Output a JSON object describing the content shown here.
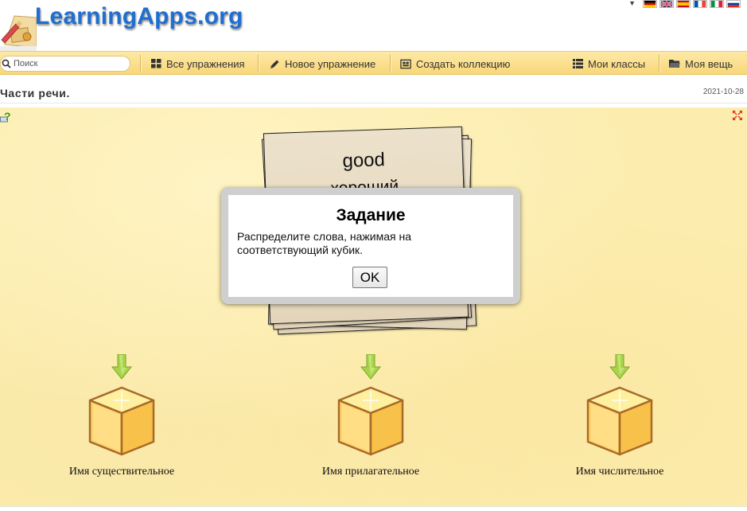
{
  "header": {
    "logo_text": "LearningApps.org",
    "languages": [
      "de",
      "en",
      "es",
      "fr",
      "it",
      "ru"
    ]
  },
  "nav": {
    "search_placeholder": "Поиск",
    "items": [
      {
        "label": "Все упражнения",
        "icon": "grid-icon"
      },
      {
        "label": "Новое упражнение",
        "icon": "pencil-icon"
      },
      {
        "label": "Создать коллекцию",
        "icon": "collection-icon"
      },
      {
        "label": "Мои классы",
        "icon": "list-icon"
      },
      {
        "label": "Моя вещь",
        "icon": "folder-icon"
      }
    ]
  },
  "app": {
    "title": "Части речи.",
    "date": "2021-10-28"
  },
  "card": {
    "word": "good",
    "translation": "хороший"
  },
  "modal": {
    "title": "Задание",
    "text": "Распределите слова, нажимая на соответствующий кубик.",
    "ok_label": "OK"
  },
  "bins": [
    {
      "label": "Имя существительное"
    },
    {
      "label": "Имя прилагательное"
    },
    {
      "label": "Имя числительное"
    }
  ],
  "colors": {
    "brand_blue": "#1f6fd0",
    "navbar": "#f8d77a",
    "stage": "#fcedaf"
  }
}
